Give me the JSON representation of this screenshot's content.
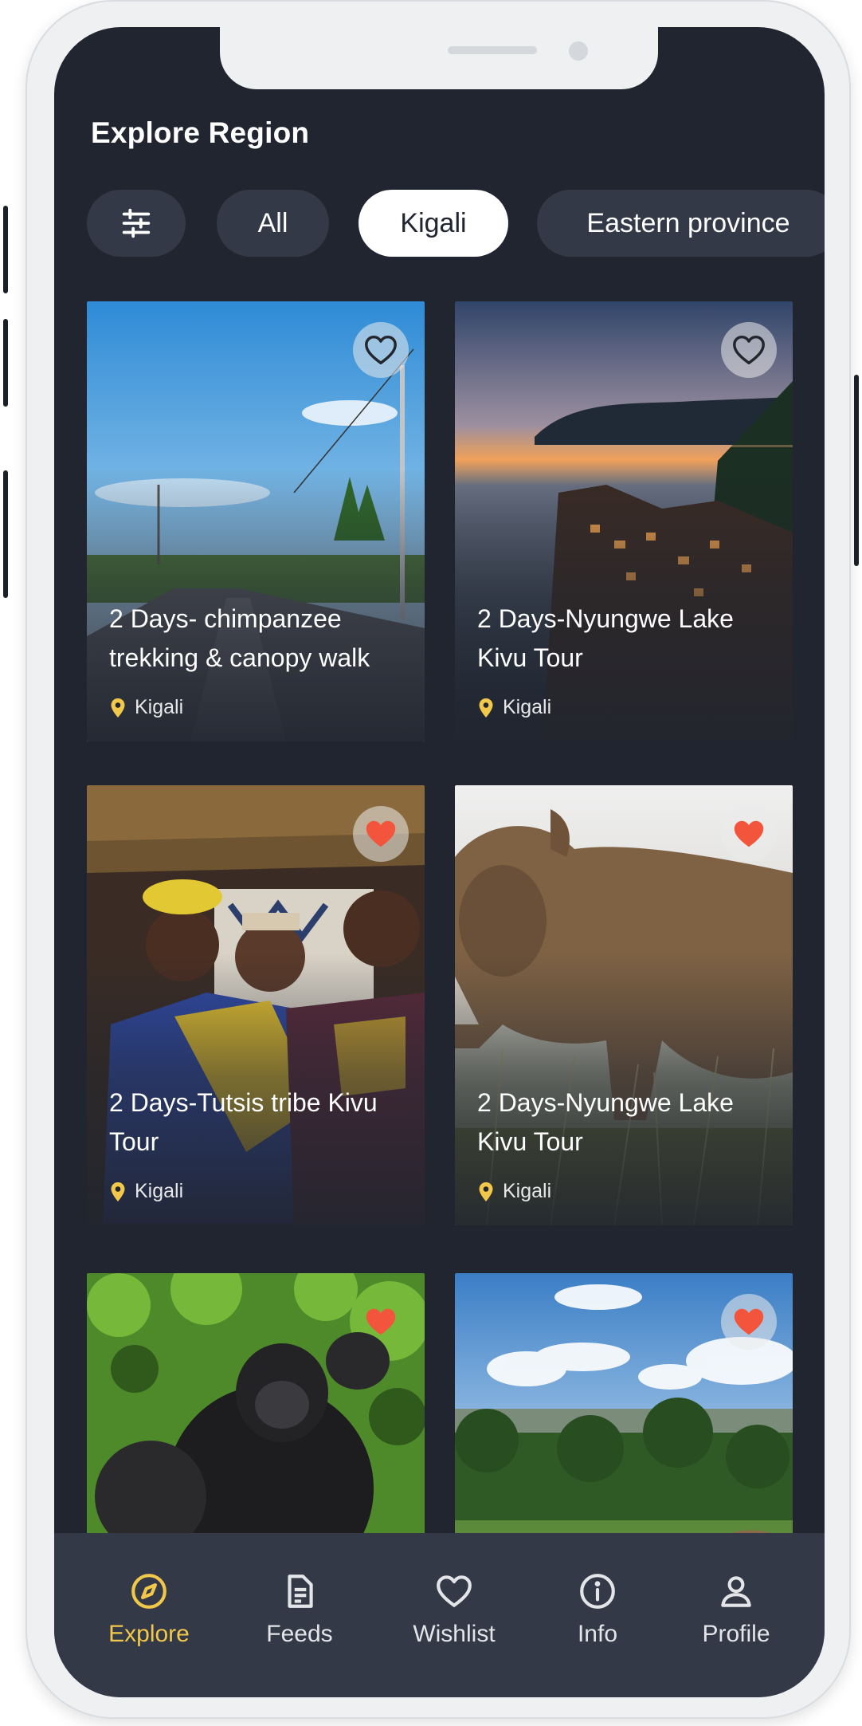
{
  "header": {
    "title": "Explore Region"
  },
  "filters": {
    "filter_icon": "sliders-icon",
    "chips": [
      {
        "label": "All"
      },
      {
        "label": "Kigali"
      },
      {
        "label": "Eastern province"
      }
    ],
    "active": "Kigali"
  },
  "tours": [
    {
      "title": "2 Days- chimpanzee trekking & canopy walk",
      "location": "Kigali",
      "favorite": false,
      "scene": "road-town"
    },
    {
      "title": "2 Days-Nyungwe Lake Kivu Tour",
      "location": "Kigali",
      "favorite": false,
      "scene": "coastal-village-dusk"
    },
    {
      "title": "2 Days-Tutsis tribe Kivu Tour",
      "location": "Kigali",
      "favorite": true,
      "scene": "tribe-people"
    },
    {
      "title": "2 Days-Nyungwe Lake Kivu Tour",
      "location": "Kigali",
      "favorite": true,
      "scene": "rhino"
    },
    {
      "title": "",
      "location": "",
      "favorite": true,
      "scene": "gorilla"
    },
    {
      "title": "",
      "location": "",
      "favorite": true,
      "scene": "hills-sky"
    }
  ],
  "nav": {
    "items": [
      {
        "label": "Explore",
        "icon": "compass-icon"
      },
      {
        "label": "Feeds",
        "icon": "document-icon"
      },
      {
        "label": "Wishlist",
        "icon": "heart-icon"
      },
      {
        "label": "Info",
        "icon": "info-icon"
      },
      {
        "label": "Profile",
        "icon": "user-icon"
      }
    ],
    "active": "Explore"
  },
  "colors": {
    "background": "#21252f",
    "surface": "#333946",
    "accent": "#f2c84b",
    "favorite": "#f2553b"
  }
}
